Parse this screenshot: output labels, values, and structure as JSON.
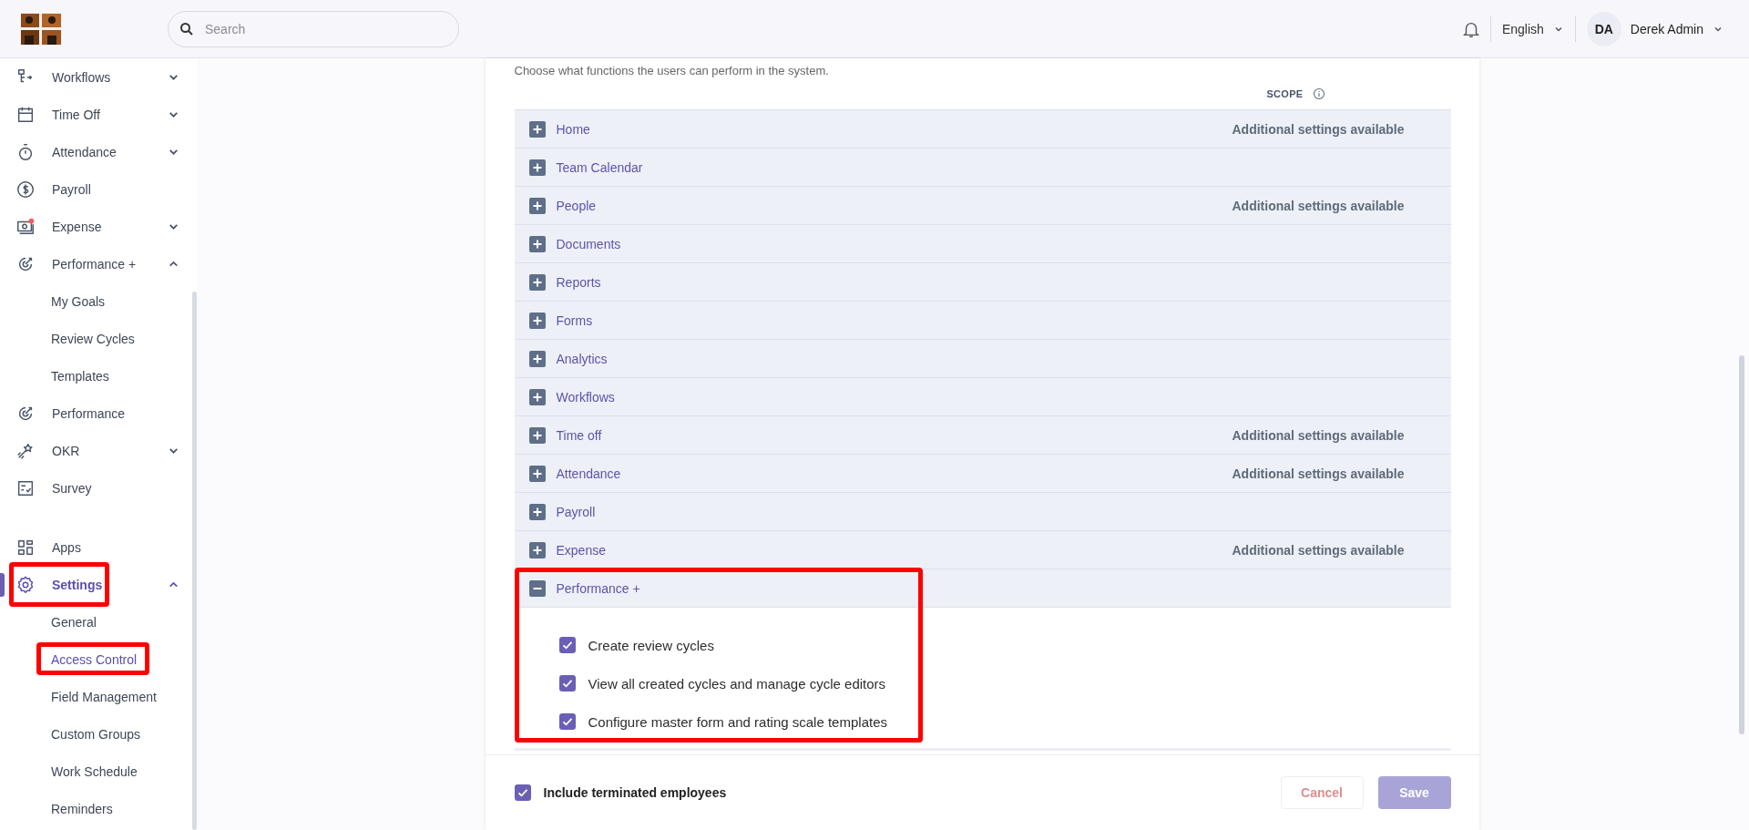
{
  "header": {
    "search": {
      "placeholder": "Search"
    },
    "language": "English",
    "user": {
      "initials": "DA",
      "name": "Derek Admin"
    }
  },
  "sidebar": {
    "main": [
      {
        "label": "Workflows",
        "expanded": false
      },
      {
        "label": "Time Off",
        "expanded": false
      },
      {
        "label": "Attendance",
        "expanded": false
      },
      {
        "label": "Payroll"
      },
      {
        "label": "Expense",
        "expanded": false
      },
      {
        "label": "Performance +",
        "expanded": true,
        "children": [
          {
            "label": "My Goals",
            "selected": false
          },
          {
            "label": "Review Cycles",
            "selected": false
          },
          {
            "label": "Templates",
            "selected": false
          }
        ]
      },
      {
        "label": "Performance"
      },
      {
        "label": "OKR",
        "expanded": false
      },
      {
        "label": "Survey"
      }
    ],
    "bottom": [
      {
        "label": "Apps"
      },
      {
        "label": "Settings",
        "expanded": true,
        "selected": true,
        "highlighted": true,
        "children": [
          {
            "label": "General",
            "selected": false
          },
          {
            "label": "Access Control",
            "selected": true,
            "highlighted": true
          },
          {
            "label": "Field Management",
            "selected": false
          },
          {
            "label": "Custom Groups",
            "selected": false
          },
          {
            "label": "Work Schedule",
            "selected": false
          },
          {
            "label": "Reminders",
            "selected": false
          }
        ]
      }
    ]
  },
  "access": {
    "description": "Choose what functions the users can perform in the system.",
    "scope_heading": "SCOPE",
    "modules": [
      {
        "label": "Home",
        "expanded": false,
        "note": "Additional settings available"
      },
      {
        "label": "Team Calendar",
        "expanded": false
      },
      {
        "label": "People",
        "expanded": false,
        "note": "Additional settings available"
      },
      {
        "label": "Documents",
        "expanded": false
      },
      {
        "label": "Reports",
        "expanded": false
      },
      {
        "label": "Forms",
        "expanded": false
      },
      {
        "label": "Analytics",
        "expanded": false
      },
      {
        "label": "Workflows",
        "expanded": false
      },
      {
        "label": "Time off",
        "expanded": false,
        "note": "Additional settings available"
      },
      {
        "label": "Attendance",
        "expanded": false,
        "note": "Additional settings available"
      },
      {
        "label": "Payroll",
        "expanded": false
      },
      {
        "label": "Expense",
        "expanded": false,
        "note": "Additional settings available"
      },
      {
        "label": "Performance +",
        "expanded": true,
        "highlighted": true,
        "permissions": [
          {
            "label": "Create review cycles",
            "checked": true
          },
          {
            "label": "View all created cycles and manage cycle editors",
            "checked": true
          },
          {
            "label": "Configure master form and rating scale templates",
            "checked": true
          }
        ]
      }
    ]
  },
  "footer": {
    "include_terminated": {
      "label": "Include terminated employees",
      "checked": true
    },
    "cancel": {
      "label": "Cancel",
      "disabled": true
    },
    "save": {
      "label": "Save",
      "disabled": true
    }
  }
}
